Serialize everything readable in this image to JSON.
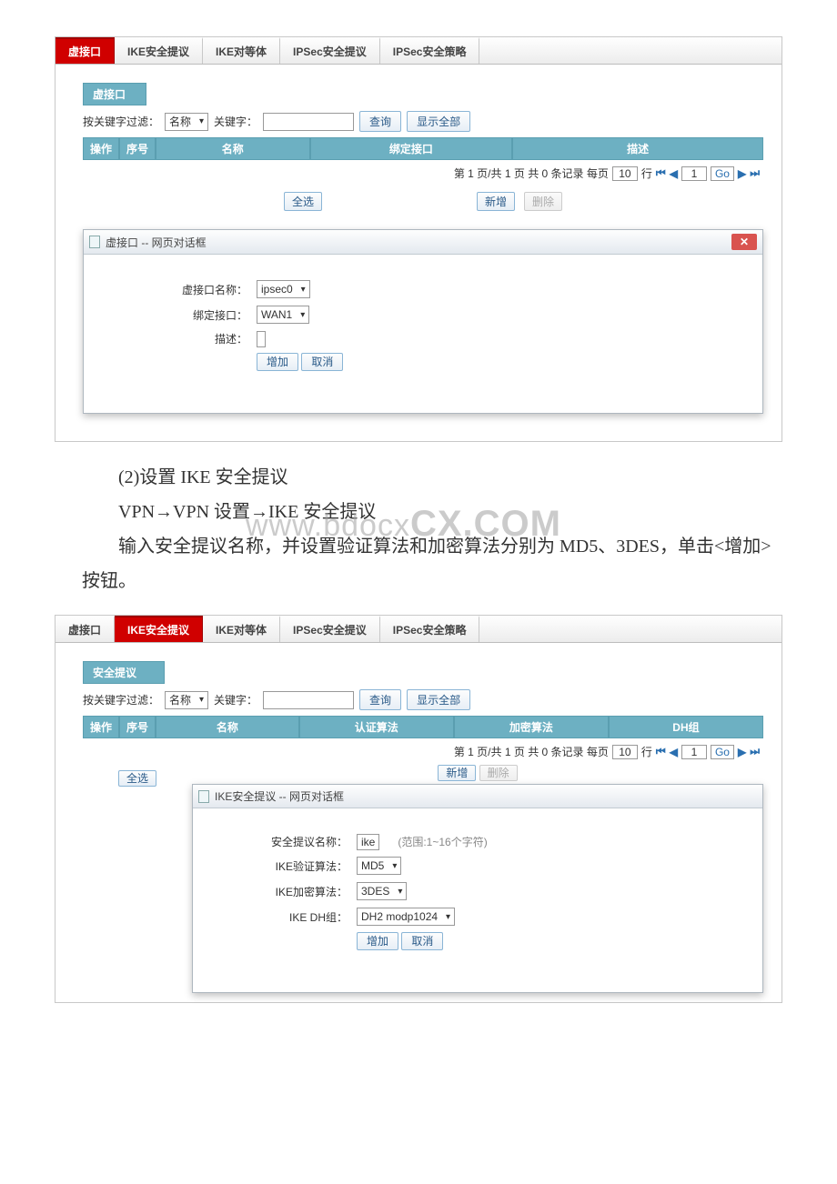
{
  "panel1": {
    "tabs": [
      "虚接口",
      "IKE安全提议",
      "IKE对等体",
      "IPSec安全提议",
      "IPSec安全策略"
    ],
    "active_tab": 0,
    "section_title": "虚接口",
    "filter": {
      "label": "按关键字过滤：",
      "sel": "名称",
      "kw_label": "关键字：",
      "search_btn": "查询",
      "showall_btn": "显示全部"
    },
    "thead": {
      "op": "操作",
      "idx": "序号",
      "name": "名称",
      "bind": "绑定接口",
      "desc": "描述"
    },
    "pager": {
      "text1": "第 1 页/共 1 页 共 0 条记录 每页",
      "per_page": "10",
      "text2": "行",
      "page_no": "1",
      "go": "Go"
    },
    "actions": {
      "selectall": "全选",
      "add": "新增",
      "del": "删除"
    },
    "dialog": {
      "title": "虚接口 -- 网页对话框",
      "rows": {
        "name_label": "虚接口名称：",
        "name_value": "ipsec0",
        "bind_label": "绑定接口：",
        "bind_value": "WAN1",
        "desc_label": "描述："
      },
      "ok": "增加",
      "cancel": "取消"
    }
  },
  "prose": {
    "line1": "(2)设置 IKE 安全提议",
    "line2": "VPN→VPN 设置→IKE 安全提议",
    "line3": "输入安全提议名称，并设置验证算法和加密算法分别为 MD5、3DES，单击<增加>按钮。"
  },
  "watermark": {
    "a": "www.bdocx",
    "b": "CX.COM"
  },
  "panel2": {
    "tabs": [
      "虚接口",
      "IKE安全提议",
      "IKE对等体",
      "IPSec安全提议",
      "IPSec安全策略"
    ],
    "active_tab": 1,
    "section_title": "安全提议",
    "filter": {
      "label": "按关键字过滤：",
      "sel": "名称",
      "kw_label": "关键字：",
      "search_btn": "查询",
      "showall_btn": "显示全部"
    },
    "thead": {
      "op": "操作",
      "idx": "序号",
      "name": "名称",
      "auth": "认证算法",
      "enc": "加密算法",
      "dh": "DH组"
    },
    "pager": {
      "text1": "第 1 页/共 1 页 共 0 条记录 每页",
      "per_page": "10",
      "text2": "行",
      "page_no": "1",
      "go": "Go"
    },
    "actions": {
      "selectall": "全选",
      "add": "新增",
      "del": "删除"
    },
    "dialog": {
      "title": "IKE安全提议 -- 网页对话框",
      "rows": {
        "name_label": "安全提议名称：",
        "name_value": "ike",
        "name_hint": "(范围:1~16个字符)",
        "auth_label": "IKE验证算法：",
        "auth_value": "MD5",
        "enc_label": "IKE加密算法：",
        "enc_value": "3DES",
        "dh_label": "IKE DH组：",
        "dh_value": "DH2 modp1024"
      },
      "ok": "增加",
      "cancel": "取消"
    }
  }
}
